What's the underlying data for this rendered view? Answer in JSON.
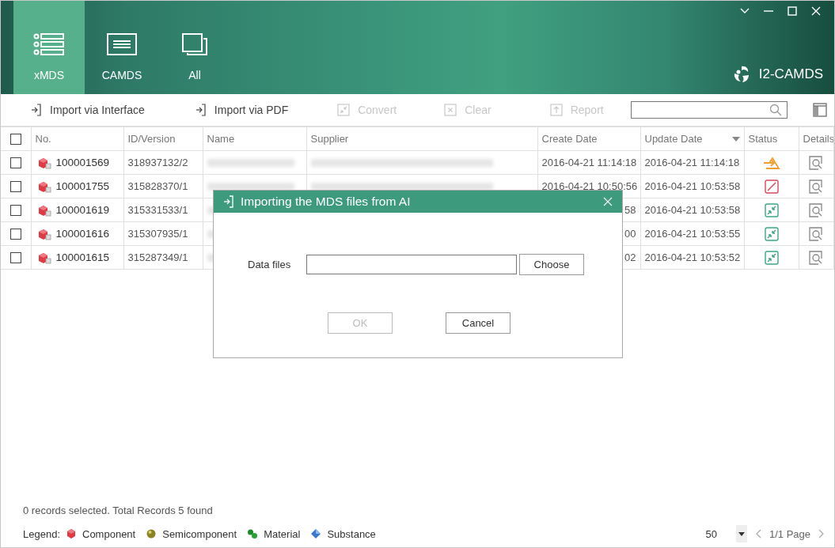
{
  "tabs": [
    {
      "label": "xMDS",
      "kind": "list",
      "selected": true
    },
    {
      "label": "CAMDS",
      "kind": "card",
      "selected": false
    },
    {
      "label": "All",
      "kind": "stack",
      "selected": false
    }
  ],
  "brand": "I2-CAMDS",
  "toolbar": [
    {
      "label": "Import via Interface",
      "kind": "import",
      "disabled": false
    },
    {
      "label": "Import via PDF",
      "kind": "import",
      "disabled": false
    },
    {
      "label": "Convert",
      "kind": "convert",
      "disabled": true
    },
    {
      "label": "Clear",
      "kind": "clear",
      "disabled": true
    },
    {
      "label": "Report",
      "kind": "report",
      "disabled": true
    }
  ],
  "table": {
    "select_all": {
      "checked": false
    },
    "columns": [
      {
        "label": "No.",
        "sorted": false
      },
      {
        "label": "ID/Version",
        "sorted": false
      },
      {
        "label": "Name",
        "sorted": false
      },
      {
        "label": "Supplier",
        "sorted": false
      },
      {
        "label": "Create Date",
        "sorted": false
      },
      {
        "label": "Update Date",
        "sorted": true
      },
      {
        "label": "Status",
        "sorted": false
      },
      {
        "label": "Details",
        "sorted": false
      }
    ],
    "rows": [
      {
        "checked": false,
        "no": "100001569",
        "id_version": "318937132/2",
        "create_date": "2016-04-21 11:14:18",
        "update_date": "2016-04-21 11:14:18",
        "kind": "pending"
      },
      {
        "checked": false,
        "no": "100001755",
        "id_version": "315828370/1",
        "create_date": "2016-04-21 10:50:56",
        "update_date": "2016-04-21 10:53:58",
        "kind": "invalid"
      },
      {
        "checked": false,
        "no": "100001619",
        "id_version": "315331533/1",
        "create_date": "58",
        "update_date": "2016-04-21 10:53:58",
        "kind": "converted"
      },
      {
        "checked": false,
        "no": "100001616",
        "id_version": "315307935/1",
        "create_date": "00",
        "update_date": "2016-04-21 10:53:55",
        "kind": "converted"
      },
      {
        "checked": false,
        "no": "100001615",
        "id_version": "315287349/1",
        "create_date": "02",
        "update_date": "2016-04-21 10:53:52",
        "kind": "converted"
      }
    ]
  },
  "footer": {
    "summary": "0 records selected. Total Records 5 found",
    "legend_label": "Legend:",
    "legend": [
      {
        "kind": "component",
        "label": "Component"
      },
      {
        "kind": "semicomponent",
        "label": "Semicomponent"
      },
      {
        "kind": "material",
        "label": "Material"
      },
      {
        "kind": "substance",
        "label": "Substance"
      }
    ],
    "page_size": "50",
    "page": "1/1 Page"
  },
  "dialog": {
    "title": "Importing the MDS files from AI",
    "field_label": "Data files",
    "choose": "Choose",
    "buttons": [
      {
        "label": "OK",
        "disabled": true
      },
      {
        "label": "Cancel",
        "disabled": false
      }
    ]
  }
}
